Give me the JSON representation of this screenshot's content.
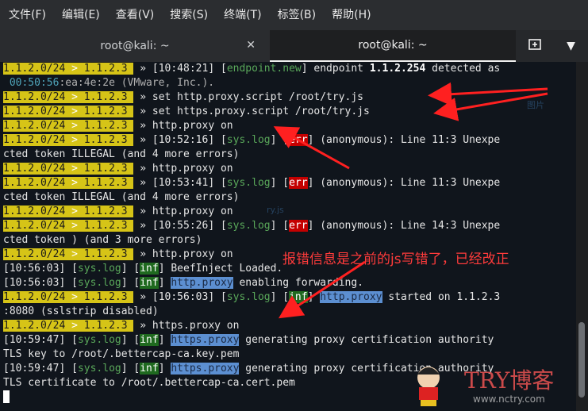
{
  "menu": [
    "文件(F)",
    "编辑(E)",
    "查看(V)",
    "搜索(S)",
    "终端(T)",
    "标签(B)",
    "帮助(H)"
  ],
  "tabs": [
    {
      "label": "root@kali: ~"
    },
    {
      "label": "root@kali: ~"
    }
  ],
  "prompt": {
    "net": "1.1.2.0/24",
    "sep": " > ",
    "host": "1.1.2.3 ",
    "chev": "» "
  },
  "term": {
    "l1_time": "[10:48:21]",
    "l1_event": "endpoint.new",
    "l1_text": " endpoint ",
    "l1_ip": "1.1.2.254",
    "l1_rest": " detected as",
    "l2_mac": " 00:50:56",
    "l2_rest": ":ea:4e:2e (VMware, Inc.).",
    "cmd1": "set http.proxy.script /root/try.js",
    "cmd2": "set https.proxy.script /root/try.js",
    "cmd3": "http.proxy on",
    "t4": "[10:52:16]",
    "msg4": " (anonymous): Line 11:3 Unexpe",
    "c4": "cted token ILLEGAL (and 4 more errors)",
    "t5": "[10:53:41]",
    "msg5": " (anonymous): Line 11:3 Unexpe",
    "c5": "cted token ILLEGAL (and 4 more errors)",
    "t6": "[10:55:26]",
    "msg6": " (anonymous): Line 14:3 Unexpe",
    "c6": "cted token ) (and 3 more errors)",
    "l_beef_t": "[10:56:03]",
    "l_beef": " BeefInject Loaded.",
    "l_fwd_t": "[10:56:03]",
    "l_fwd_mod": "http.proxy",
    "l_fwd": " enabling forwarding.",
    "l_start_t": "[10:56:03]",
    "l_start_mod": "http.proxy",
    "l_start": " started on 1.1.2.3",
    "l_ssl": ":8080 (sslstrip disabled)",
    "cmd4": "https.proxy on",
    "l_gen1_t": "[10:59:47]",
    "l_gen1_mod": "https.proxy",
    "l_gen1": " generating proxy certification authority",
    "l_key": "TLS key to /root/.bettercap-ca.key.pem",
    "l_gen2_t": "[10:59:47]",
    "l_gen2_mod": "https.proxy",
    "l_gen2": " generating proxy certification authority",
    "l_cert": "TLS certificate to /root/.bettercap-ca.cert.pem",
    "syslog": "sys.log",
    "err": "err",
    "inf": "inf"
  },
  "annotation": "报错信息是之前的js写错了，已经改正",
  "watermark": {
    "brand": "TRY博客",
    "url": "www.nctry.com"
  },
  "ghost": {
    "g1": "图片",
    "g2": "ry.js"
  },
  "colors": {
    "prompt": "#d6c417",
    "err": "#c40000",
    "inf": "#1f6a1f",
    "annotation": "#ff3b3b"
  }
}
